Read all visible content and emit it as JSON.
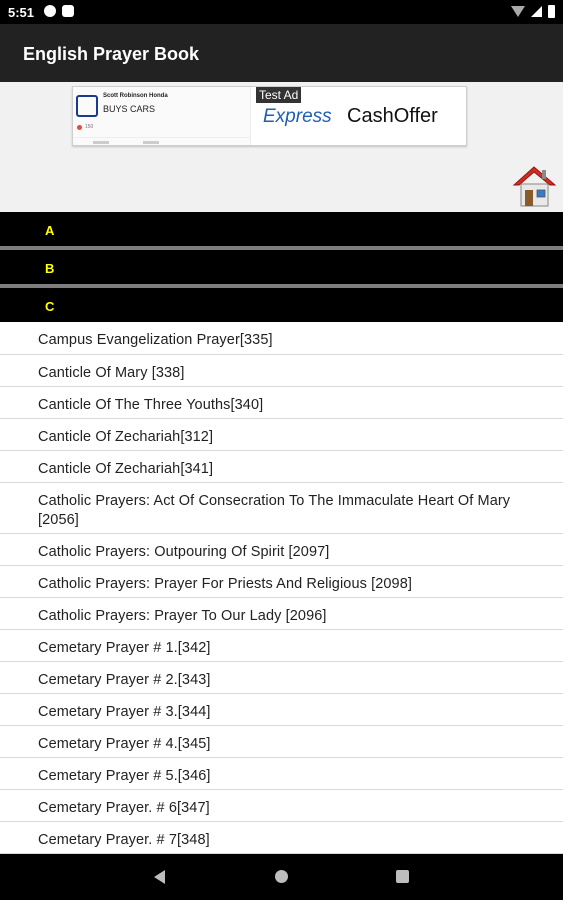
{
  "status_bar": {
    "time": "5:51",
    "left_icons": [
      "notification-p-icon",
      "sd-card-icon"
    ],
    "right_icons": [
      "wifi-icon",
      "signal-icon",
      "battery-icon"
    ]
  },
  "app_bar": {
    "title": "English Prayer Book"
  },
  "ad": {
    "dealer": "Scott Robinson Honda",
    "headline": "BUYS CARS",
    "reactions": "150",
    "badge": "Test Ad",
    "brand_express": "Express",
    "brand_cashoffer": "CashOffer"
  },
  "home_icon": "home-icon",
  "sections": [
    {
      "letter": "A"
    },
    {
      "letter": "B"
    },
    {
      "letter": "C"
    }
  ],
  "items": [
    {
      "label": "Campus Evangelization Prayer[335]"
    },
    {
      "label": "Canticle Of Mary [338]"
    },
    {
      "label": "Canticle Of The Three Youths[340]"
    },
    {
      "label": "Canticle Of Zechariah[312]"
    },
    {
      "label": "Canticle Of Zechariah[341]"
    },
    {
      "label": "Catholic Prayers: Act Of Consecration To The Immaculate Heart Of Mary [2056]"
    },
    {
      "label": "Catholic Prayers: Outpouring Of Spirit [2097]"
    },
    {
      "label": "Catholic Prayers: Prayer For Priests And Religious [2098]"
    },
    {
      "label": "Catholic Prayers: Prayer To Our Lady [2096]"
    },
    {
      "label": "Cemetary Prayer # 1.[342]"
    },
    {
      "label": "Cemetary Prayer # 2.[343]"
    },
    {
      "label": "Cemetary Prayer # 3.[344]"
    },
    {
      "label": "Cemetary Prayer # 4.[345]"
    },
    {
      "label": "Cemetary Prayer # 5.[346]"
    },
    {
      "label": "Cemetary Prayer. # 6[347]"
    },
    {
      "label": "Cemetary Prayer. # 7[348]"
    }
  ],
  "nav_bar": {
    "icons": [
      "back-icon",
      "home-circle-icon",
      "recents-icon"
    ]
  }
}
